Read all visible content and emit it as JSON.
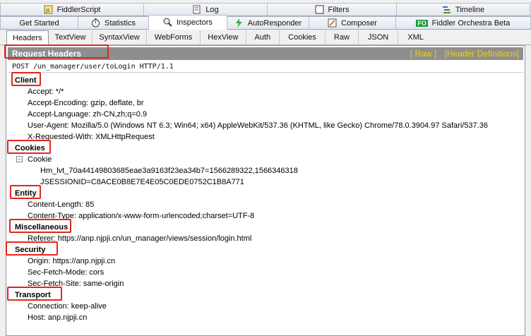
{
  "top_tabs_row1": [
    {
      "label": "FiddlerScript",
      "icon": "script-icon"
    },
    {
      "label": "Log",
      "icon": "log-icon"
    },
    {
      "label": "Filters",
      "icon": "checkbox-icon"
    },
    {
      "label": "Timeline",
      "icon": "timeline-icon"
    }
  ],
  "top_tabs_row2": [
    {
      "label": "Get Started"
    },
    {
      "label": "Statistics",
      "icon": "stopwatch-icon"
    },
    {
      "label": "Inspectors",
      "icon": "inspector-icon"
    },
    {
      "label": "AutoResponder",
      "icon": "lightning-icon"
    },
    {
      "label": "Composer",
      "icon": "pencil-icon"
    },
    {
      "label": "Fiddler Orchestra Beta",
      "icon": "fo-icon",
      "icon_text": "FO"
    }
  ],
  "subtabs": [
    "Headers",
    "TextView",
    "SyntaxView",
    "WebForms",
    "HexView",
    "Auth",
    "Cookies",
    "Raw",
    "JSON",
    "XML"
  ],
  "panel": {
    "title": "Request Headers",
    "raw_link": "[ Raw ]",
    "defs_link": "[Header Definitions]",
    "request_line": "POST /un_manager/user/toLogin HTTP/1.1"
  },
  "groups": {
    "client": {
      "name": "Client",
      "items": [
        "Accept: */*",
        "Accept-Encoding: gzip, deflate, br",
        "Accept-Language: zh-CN,zh;q=0.9",
        "User-Agent: Mozilla/5.0 (Windows NT 6.3; Win64; x64) AppleWebKit/537.36 (KHTML, like Gecko) Chrome/78.0.3904.97 Safari/537.36",
        "X-Requested-With: XMLHttpRequest"
      ]
    },
    "cookies": {
      "name": "Cookies",
      "cookie_label": "Cookie",
      "expander": "−",
      "items": [
        "Hm_lvt_70a44149803685eae3a9163f23ea34b7=1566289322,1566346318",
        "JSESSIONID=C8ACE0B8E7E4E05C0EDE0752C1B8A771"
      ]
    },
    "entity": {
      "name": "Entity",
      "items": [
        "Content-Length: 85",
        "Content-Type: application/x-www-form-urlencoded;charset=UTF-8"
      ]
    },
    "misc": {
      "name": "Miscellaneous",
      "items": [
        "Referer: https://anp.njpji.cn/un_manager/views/session/login.html"
      ]
    },
    "security": {
      "name": "Security",
      "items": [
        "Origin: https://anp.njpji.cn",
        "Sec-Fetch-Mode: cors",
        "Sec-Fetch-Site: same-origin"
      ]
    },
    "transport": {
      "name": "Transport",
      "items": [
        "Connection: keep-alive",
        "Host: anp.njpji.cn"
      ]
    }
  },
  "colors": {
    "annotation_red": "#e8231b",
    "header_bar": "#8e8e8e",
    "link_yellow": "#f2d200"
  }
}
